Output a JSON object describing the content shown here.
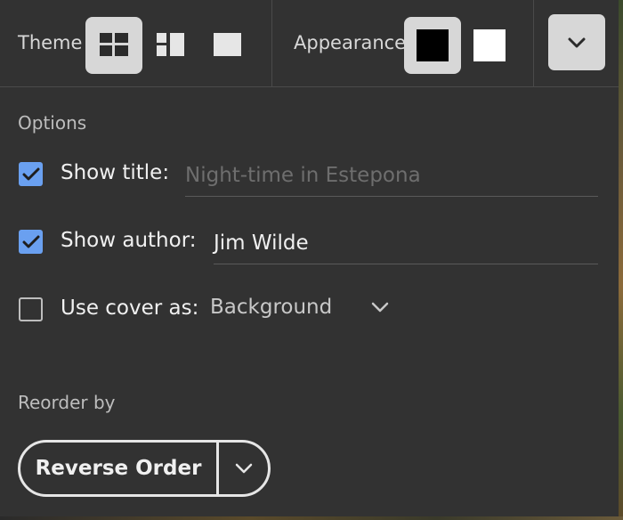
{
  "toolbar": {
    "theme_label": "Theme",
    "appearance_label": "Appearance",
    "themes": [
      "grid-layout-icon",
      "columns-layout-icon",
      "single-layout-icon"
    ],
    "selected_theme": "grid-layout-icon",
    "appearances": [
      "dark-swatch-icon",
      "light-swatch-icon"
    ],
    "selected_appearance": "dark-swatch-icon"
  },
  "options": {
    "heading": "Options",
    "show_title": {
      "label": "Show title:",
      "checked": true,
      "placeholder": "Night-time in Estepona",
      "value": ""
    },
    "show_author": {
      "label": "Show author:",
      "checked": true,
      "value": "Jim Wilde"
    },
    "use_cover": {
      "label": "Use cover as:",
      "checked": false,
      "selected": "Background"
    }
  },
  "reorder": {
    "heading": "Reorder by",
    "button_label": "Reverse Order"
  },
  "colors": {
    "background": "#323232",
    "checkbox_accent": "#6aa0f0",
    "selected_button": "#d7d7d7"
  }
}
